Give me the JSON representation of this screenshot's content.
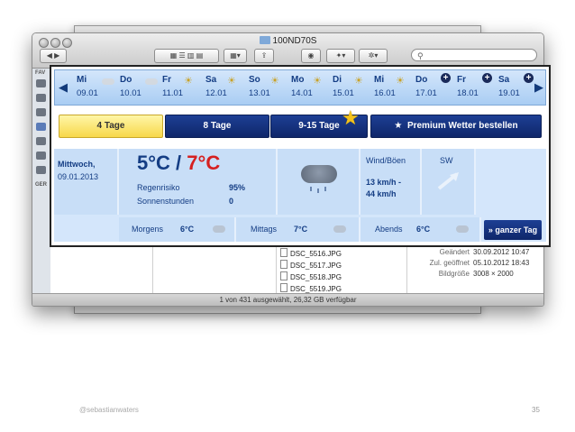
{
  "finder": {
    "title": "100ND70S",
    "search_icon": "magnifier-icon",
    "sidebar_labels": [
      "FAV",
      "GER"
    ],
    "files": [
      "DSC_5516.JPG",
      "DSC_5517.JPG",
      "DSC_5518.JPG",
      "DSC_5519.JPG"
    ],
    "meta": [
      {
        "key": "Geändert",
        "value": "30.09.2012 10:47"
      },
      {
        "key": "Zul. geöffnet",
        "value": "05.10.2012 18:43"
      },
      {
        "key": "Bildgröße",
        "value": "3008 × 2000"
      }
    ],
    "status": "1 von 431 ausgewählt, 26,32 GB verfügbar"
  },
  "weather": {
    "days": [
      {
        "name": "Mi",
        "date": "09.01",
        "icon": "sun-cloud-icon"
      },
      {
        "name": "Do",
        "date": "10.01",
        "icon": "sun-cloud-icon"
      },
      {
        "name": "Fr",
        "date": "11.01",
        "icon": "sun-cloud-icon"
      },
      {
        "name": "Sa",
        "date": "12.01",
        "icon": "sun-cloud-icon"
      },
      {
        "name": "So",
        "date": "13.01",
        "icon": "sun-cloud-icon"
      },
      {
        "name": "Mo",
        "date": "14.01",
        "icon": "sun-cloud-icon"
      },
      {
        "name": "Di",
        "date": "15.01",
        "icon": "sun-cloud-icon"
      },
      {
        "name": "Mi",
        "date": "16.01",
        "icon": "sun-cloud-icon"
      },
      {
        "name": "Do",
        "date": "17.01",
        "icon": "plus-icon"
      },
      {
        "name": "Fr",
        "date": "18.01",
        "icon": "plus-icon"
      },
      {
        "name": "Sa",
        "date": "19.01",
        "icon": "plus-icon"
      }
    ],
    "buttons": {
      "tab_4": "4 Tage",
      "tab_8": "8 Tage",
      "tab_15": "9-15 Tage",
      "premium": "Premium Wetter bestellen"
    },
    "today": {
      "day": "Mittwoch,",
      "date": "09.01.2013",
      "temp_low": "5°C /",
      "temp_high": "7°C",
      "rain_label": "Regenrisiko",
      "rain_value": "95%",
      "sun_label": "Sonnenstunden",
      "sun_value": "0",
      "wind_label": "Wind/Böen",
      "wind_speed": "13 km/h -",
      "wind_gust": "44 km/h",
      "wind_dir": "SW"
    },
    "periods": [
      {
        "label": "Morgens",
        "temp": "6°C"
      },
      {
        "label": "Mittags",
        "temp": "7°C"
      },
      {
        "label": "Abends",
        "temp": "6°C"
      }
    ],
    "ganzer_tag": "» ganzer Tag"
  },
  "footer": {
    "author": "@sebastianwaters",
    "page": "35"
  }
}
